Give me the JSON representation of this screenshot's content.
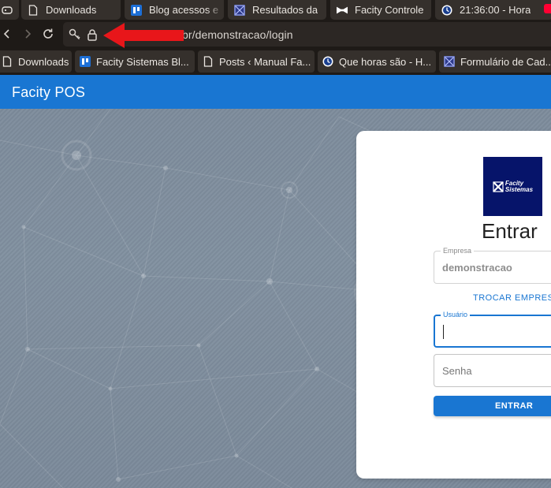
{
  "browser": {
    "tabs": [
      {
        "label": "",
        "icon": "gamepad-icon"
      },
      {
        "label": "Downloads",
        "icon": "page-icon"
      },
      {
        "label": "Blog acessos e",
        "icon": "trello-icon"
      },
      {
        "label": "Resultados da",
        "icon": "form-grid-icon"
      },
      {
        "label": "Facity Controle",
        "icon": "bowtie-icon"
      },
      {
        "label": "21:36:00 - Hora",
        "icon": "clock-icon"
      },
      {
        "label": "",
        "icon": "youtube-icon"
      }
    ],
    "url": "br/demonstracao/login",
    "bookmarks": [
      {
        "label": "Downloads",
        "icon": "page-icon"
      },
      {
        "label": "Facity Sistemas Bl...",
        "icon": "trello-icon"
      },
      {
        "label": "Posts ‹ Manual Fa...",
        "icon": "page-icon"
      },
      {
        "label": "Que horas são - H...",
        "icon": "clock-icon"
      },
      {
        "label": "Formulário de Cad...",
        "icon": "form-grid-icon"
      }
    ]
  },
  "app": {
    "title": "Facity POS"
  },
  "login": {
    "logo_line1": "Facity",
    "logo_line2": "Sistemas",
    "heading": "Entrar",
    "company_label": "Empresa",
    "company_value": "demonstracao",
    "switch_company": "TROCAR EMPRESA",
    "user_label": "Usuário",
    "user_value": "",
    "password_placeholder": "Senha",
    "submit_label": "ENTRAR"
  },
  "colors": {
    "primary": "#1976d2",
    "logo_background": "#06146a",
    "annotation_arrow": "#e8161a",
    "browser_frame": "#1e1a17"
  }
}
